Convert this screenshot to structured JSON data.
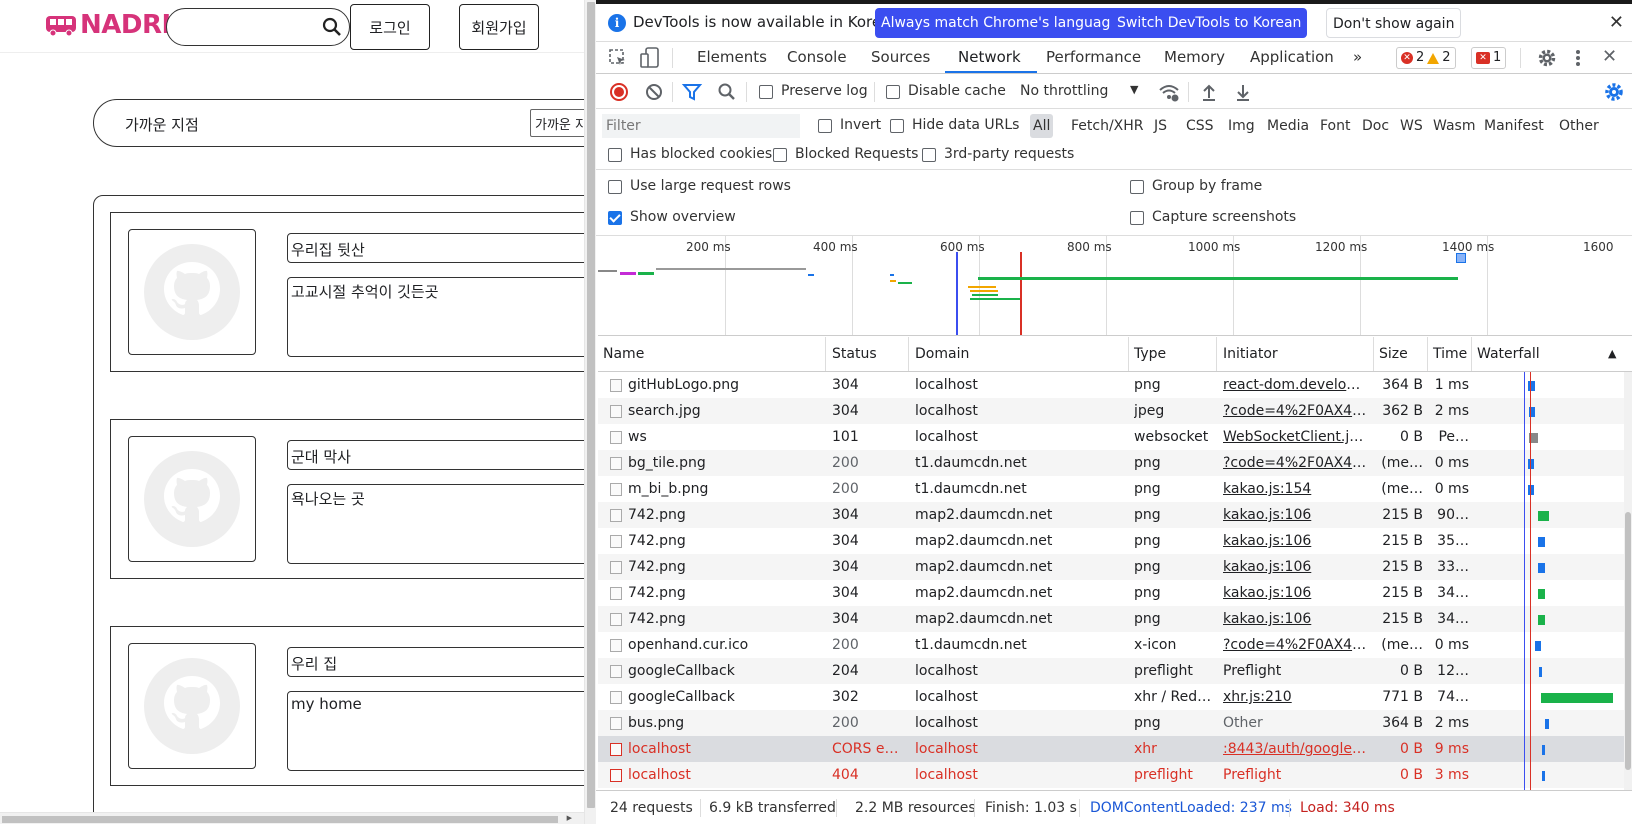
{
  "page": {
    "logo_text": "NADRI",
    "search_placeholder": "",
    "login_label": "로그인",
    "signup_label": "회원가입",
    "nearby_label": "가까운 지점",
    "nearby_select_value": "가까운 지점",
    "cards": [
      {
        "title": "우리집 뒷산",
        "description": "고교시절 추억이 깃든곳"
      },
      {
        "title": "군대 막사",
        "description": "욕나오는 곳"
      },
      {
        "title": "우리 집",
        "description": "my home"
      }
    ]
  },
  "devtools": {
    "infobar": {
      "message": "DevTools is now available in Korean!",
      "match_language": "Always match Chrome's language",
      "switch_korean": "Switch DevTools to Korean",
      "dont_show": "Don't show again"
    },
    "tabs": [
      "Elements",
      "Console",
      "Sources",
      "Network",
      "Performance",
      "Memory",
      "Application"
    ],
    "active_tab": "Network",
    "more_tabs": "»",
    "counts": {
      "errors": "2",
      "warnings": "2",
      "issues": "1"
    },
    "toolbar": {
      "preserve_log": "Preserve log",
      "disable_cache": "Disable cache",
      "throttling": "No throttling"
    },
    "filter": {
      "placeholder": "Filter",
      "invert": "Invert",
      "hide_data_urls": "Hide data URLs",
      "types": [
        "All",
        "Fetch/XHR",
        "JS",
        "CSS",
        "Img",
        "Media",
        "Font",
        "Doc",
        "WS",
        "Wasm",
        "Manifest",
        "Other"
      ],
      "has_blocked_cookies": "Has blocked cookies",
      "blocked_requests": "Blocked Requests",
      "third_party": "3rd-party requests"
    },
    "options": {
      "large_rows": "Use large request rows",
      "group_by_frame": "Group by frame",
      "show_overview": "Show overview",
      "capture_screenshots": "Capture screenshots"
    },
    "overview_ticks": [
      "200 ms",
      "400 ms",
      "600 ms",
      "800 ms",
      "1000 ms",
      "1200 ms",
      "1400 ms",
      "1600"
    ],
    "columns": [
      "Name",
      "Status",
      "Domain",
      "Type",
      "Initiator",
      "Size",
      "Time",
      "Waterfall"
    ],
    "requests": [
      {
        "name": "gitHubLogo.png",
        "status": "304",
        "domain": "localhost",
        "type": "png",
        "initiator": "react-dom.develop…",
        "initiator_link": true,
        "size": "364 B",
        "time": "1 ms"
      },
      {
        "name": "search.jpg",
        "status": "304",
        "domain": "localhost",
        "type": "jpeg",
        "initiator": "?code=4%2F0AX4X…",
        "initiator_link": true,
        "size": "362 B",
        "time": "2 ms"
      },
      {
        "name": "ws",
        "status": "101",
        "domain": "localhost",
        "type": "websocket",
        "initiator": "WebSocketClient.js:16",
        "initiator_link": true,
        "size": "0 B",
        "time": "Pe…"
      },
      {
        "name": "bg_tile.png",
        "status": "200",
        "domain": "t1.daumcdn.net",
        "type": "png",
        "initiator": "?code=4%2F0AX4X…",
        "initiator_link": true,
        "size": "(me…",
        "time": "0 ms"
      },
      {
        "name": "m_bi_b.png",
        "status": "200",
        "domain": "t1.daumcdn.net",
        "type": "png",
        "initiator": "kakao.js:154",
        "initiator_link": true,
        "size": "(me…",
        "time": "0 ms"
      },
      {
        "name": "742.png",
        "status": "304",
        "domain": "map2.daumcdn.net",
        "type": "png",
        "initiator": "kakao.js:106",
        "initiator_link": true,
        "size": "215 B",
        "time": "90…"
      },
      {
        "name": "742.png",
        "status": "304",
        "domain": "map2.daumcdn.net",
        "type": "png",
        "initiator": "kakao.js:106",
        "initiator_link": true,
        "size": "215 B",
        "time": "35…"
      },
      {
        "name": "742.png",
        "status": "304",
        "domain": "map2.daumcdn.net",
        "type": "png",
        "initiator": "kakao.js:106",
        "initiator_link": true,
        "size": "215 B",
        "time": "33…"
      },
      {
        "name": "742.png",
        "status": "304",
        "domain": "map2.daumcdn.net",
        "type": "png",
        "initiator": "kakao.js:106",
        "initiator_link": true,
        "size": "215 B",
        "time": "34…"
      },
      {
        "name": "742.png",
        "status": "304",
        "domain": "map2.daumcdn.net",
        "type": "png",
        "initiator": "kakao.js:106",
        "initiator_link": true,
        "size": "215 B",
        "time": "34…"
      },
      {
        "name": "openhand.cur.ico",
        "status": "200",
        "domain": "t1.daumcdn.net",
        "type": "x-icon",
        "initiator": "?code=4%2F0AX4X…",
        "initiator_link": true,
        "size": "(me…",
        "time": "0 ms"
      },
      {
        "name": "googleCallback",
        "status": "204",
        "domain": "localhost",
        "type": "preflight",
        "initiator": "Preflight",
        "initiator_link": false,
        "size": "0 B",
        "time": "12…"
      },
      {
        "name": "googleCallback",
        "status": "302",
        "domain": "localhost",
        "type": "xhr / Redi…",
        "initiator": "xhr.js:210",
        "initiator_link": true,
        "size": "771 B",
        "time": "74…"
      },
      {
        "name": "bus.png",
        "status": "200",
        "domain": "localhost",
        "type": "png",
        "initiator": "Other",
        "initiator_link": false,
        "size": "364 B",
        "time": "2 ms"
      },
      {
        "name": "localhost",
        "status": "CORS er…",
        "domain": "localhost",
        "type": "xhr",
        "initiator": ":8443/auth/googleC…",
        "initiator_link": true,
        "size": "0 B",
        "time": "9 ms",
        "error": true,
        "selected": true
      },
      {
        "name": "localhost",
        "status": "404",
        "domain": "localhost",
        "type": "preflight",
        "initiator": "Preflight",
        "initiator_link": false,
        "size": "0 B",
        "time": "3 ms",
        "error": true
      }
    ],
    "status": {
      "requests": "24 requests",
      "transferred": "6.9 kB transferred",
      "resources": "2.2 MB resources",
      "finish": "Finish: 1.03 s",
      "dom_content_loaded": "DOMContentLoaded: 237 ms",
      "load": "Load: 340 ms"
    }
  }
}
